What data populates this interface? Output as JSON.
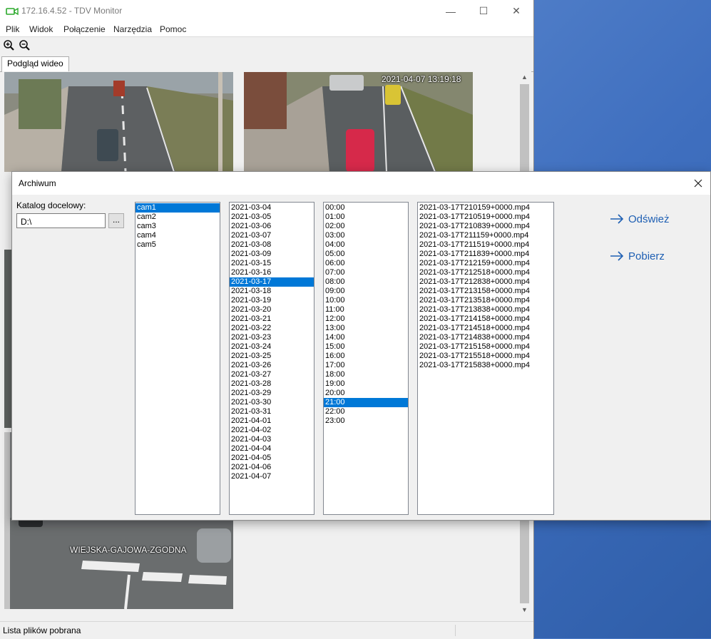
{
  "window": {
    "title": "172.16.4.52 - TDV Monitor",
    "minimize": "—",
    "maximize": "☐",
    "close": "✕"
  },
  "menu": [
    "Plik",
    "Widok",
    "Połączenie",
    "Narzędzia",
    "Pomoc"
  ],
  "tab": "Podgląd wideo",
  "video": {
    "timestamp": "2021-04-07 13:19:18",
    "cam_overlay_label": "WIEJSKA-GAJOWA-ZGODNA"
  },
  "status": "Lista plików pobrana",
  "dialog": {
    "title": "Archiwum",
    "close": "✕",
    "dir_label": "Katalog docelowy:",
    "dir_value": "D:\\",
    "browse_label": "...",
    "refresh_label": "Odśwież",
    "download_label": "Pobierz",
    "cameras": [
      "cam1",
      "cam2",
      "cam3",
      "cam4",
      "cam5"
    ],
    "selected_camera": "cam1",
    "dates": [
      "2021-03-04",
      "2021-03-05",
      "2021-03-06",
      "2021-03-07",
      "2021-03-08",
      "2021-03-09",
      "2021-03-15",
      "2021-03-16",
      "2021-03-17",
      "2021-03-18",
      "2021-03-19",
      "2021-03-20",
      "2021-03-21",
      "2021-03-22",
      "2021-03-23",
      "2021-03-24",
      "2021-03-25",
      "2021-03-26",
      "2021-03-27",
      "2021-03-28",
      "2021-03-29",
      "2021-03-30",
      "2021-03-31",
      "2021-04-01",
      "2021-04-02",
      "2021-04-03",
      "2021-04-04",
      "2021-04-05",
      "2021-04-06",
      "2021-04-07"
    ],
    "selected_date": "2021-03-17",
    "hours": [
      "00:00",
      "01:00",
      "02:00",
      "03:00",
      "04:00",
      "05:00",
      "06:00",
      "07:00",
      "08:00",
      "09:00",
      "10:00",
      "11:00",
      "12:00",
      "13:00",
      "14:00",
      "15:00",
      "16:00",
      "17:00",
      "18:00",
      "19:00",
      "20:00",
      "21:00",
      "22:00",
      "23:00"
    ],
    "selected_hour": "21:00",
    "files": [
      "2021-03-17T210159+0000.mp4",
      "2021-03-17T210519+0000.mp4",
      "2021-03-17T210839+0000.mp4",
      "2021-03-17T211159+0000.mp4",
      "2021-03-17T211519+0000.mp4",
      "2021-03-17T211839+0000.mp4",
      "2021-03-17T212159+0000.mp4",
      "2021-03-17T212518+0000.mp4",
      "2021-03-17T212838+0000.mp4",
      "2021-03-17T213158+0000.mp4",
      "2021-03-17T213518+0000.mp4",
      "2021-03-17T213838+0000.mp4",
      "2021-03-17T214158+0000.mp4",
      "2021-03-17T214518+0000.mp4",
      "2021-03-17T214838+0000.mp4",
      "2021-03-17T215158+0000.mp4",
      "2021-03-17T215518+0000.mp4",
      "2021-03-17T215838+0000.mp4"
    ]
  },
  "colors": {
    "selection": "#0078d7",
    "link": "#1e5fb3"
  }
}
